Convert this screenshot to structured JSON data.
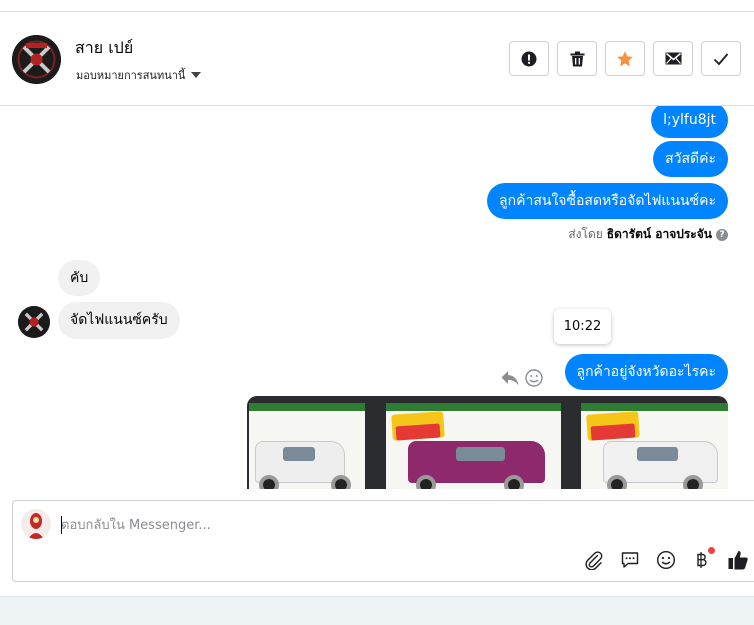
{
  "header": {
    "contact_name": "สาย เปย์",
    "assign_label": "มอบหมายการสนทนานี้",
    "buttons": [
      {
        "name": "mark-spam-button",
        "icon": "alert-icon"
      },
      {
        "name": "delete-button",
        "icon": "trash-icon"
      },
      {
        "name": "star-button",
        "icon": "star-icon"
      },
      {
        "name": "mark-unread-button",
        "icon": "envelope-icon"
      },
      {
        "name": "mark-done-button",
        "icon": "check-icon"
      }
    ]
  },
  "messages": [
    {
      "from": "page",
      "text": "l;ylfu8jt"
    },
    {
      "from": "page",
      "text": "สวัสดีค่ะ"
    },
    {
      "from": "page",
      "text": "ลูกค้าสนใจซื้อสดหรือจัดไฟแนนซ์คะ"
    },
    {
      "from": "customer",
      "text": "คับ"
    },
    {
      "from": "customer",
      "text": "จัดไฟแนนซ์ครับ"
    },
    {
      "from": "page",
      "text": "ลูกค้าอยู่จังหวัดอะไรคะ"
    }
  ],
  "sent_by": {
    "prefix": "ส่งโดย",
    "name": "ธิดารัตน์ อาจประจัน",
    "help": "?"
  },
  "timestamp": "10:22",
  "composer": {
    "placeholder": "ตอบกลับใน Messenger..."
  },
  "colors": {
    "outgoing_bubble": "#0084ff",
    "incoming_bubble": "#f0f0f0",
    "star": "#f7923a",
    "like": "#1c1e21",
    "notification_dot": "#fa3e3e"
  },
  "gallery": {
    "cards": [
      {
        "truck_color": "#f2f2f2"
      },
      {
        "truck_color": "#8e2a6b"
      },
      {
        "truck_color": "#f2f2f2"
      }
    ]
  }
}
